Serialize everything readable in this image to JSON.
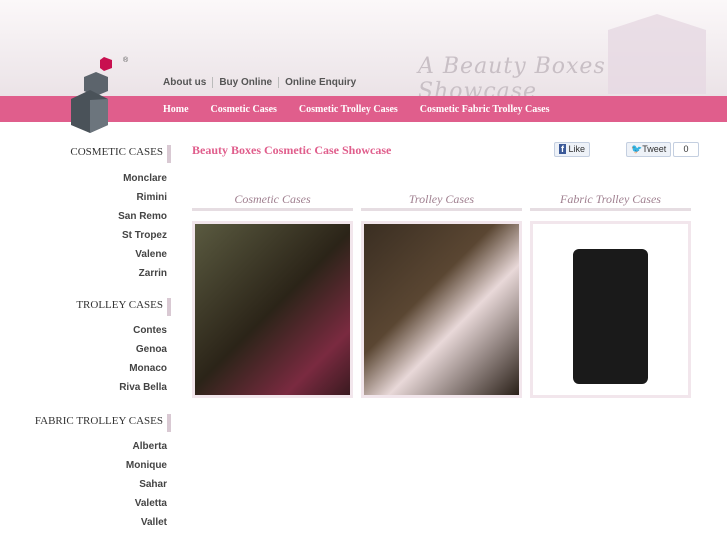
{
  "header": {
    "tagline": "A Beauty Boxes Showcase",
    "registered": "®",
    "top_links": [
      "About us",
      "Buy Online",
      "Online Enquiry"
    ]
  },
  "nav": [
    "Home",
    "Cosmetic Cases",
    "Cosmetic Trolley Cases",
    "Cosmetic Fabric Trolley Cases"
  ],
  "sidebar": [
    {
      "heading": "COSMETIC CASES",
      "items": [
        "Monclare",
        "Rimini",
        "San Remo",
        "St Tropez",
        "Valene",
        "Zarrin"
      ]
    },
    {
      "heading": "TROLLEY CASES",
      "items": [
        "Contes",
        "Genoa",
        "Monaco",
        "Riva Bella"
      ]
    },
    {
      "heading": "FABRIC TROLLEY CASES",
      "items": [
        "Alberta",
        "Monique",
        "Sahar",
        "Valetta",
        "Vallet"
      ]
    }
  ],
  "main": {
    "title": "Beauty Boxes Cosmetic Case Showcase",
    "like": "Like",
    "tweet": "Tweet",
    "tweet_count": "0",
    "columns": [
      "Cosmetic Cases",
      "Trolley Cases",
      "Fabric Trolley Cases"
    ]
  }
}
